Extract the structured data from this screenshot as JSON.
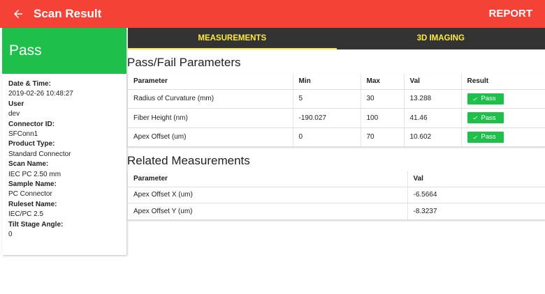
{
  "appbar": {
    "title": "Scan Result",
    "report_label": "REPORT",
    "color": "#f44336"
  },
  "summary": {
    "status": "Pass",
    "status_color": "#1fbf4c"
  },
  "info": [
    {
      "label": "Date & Time:",
      "value": "2019-02-26 10:48:27"
    },
    {
      "label": "User",
      "value": "dev"
    },
    {
      "label": "Connector ID:",
      "value": "SFConn1"
    },
    {
      "label": "Product Type:",
      "value": "Standard Connector"
    },
    {
      "label": "Scan Name:",
      "value": "IEC PC 2.50 mm"
    },
    {
      "label": "Sample Name:",
      "value": "PC Connector"
    },
    {
      "label": "Ruleset Name:",
      "value": "IEC/PC 2.5"
    },
    {
      "label": "Tilt Stage Angle:",
      "value": "0"
    }
  ],
  "tabs": [
    {
      "label": "MEASUREMENTS",
      "active": true
    },
    {
      "label": "3D IMAGING",
      "active": false
    }
  ],
  "pass_fail": {
    "title": "Pass/Fail Parameters",
    "headers": [
      "Parameter",
      "Min",
      "Max",
      "Val",
      "Result"
    ],
    "rows": [
      {
        "parameter": "Radius of Curvature (mm)",
        "min": "5",
        "max": "30",
        "val": "13.288",
        "result": "Pass"
      },
      {
        "parameter": "Fiber Height (nm)",
        "min": "-190.027",
        "max": "100",
        "val": "41.46",
        "result": "Pass"
      },
      {
        "parameter": "Apex Offset (um)",
        "min": "0",
        "max": "70",
        "val": "10.602",
        "result": "Pass"
      }
    ]
  },
  "related": {
    "title": "Related Measurements",
    "headers": [
      "Parameter",
      "Val"
    ],
    "rows": [
      {
        "parameter": "Apex Offset X (um)",
        "val": "-6.5664"
      },
      {
        "parameter": "Apex Offset Y (um)",
        "val": "-8.3237"
      }
    ]
  },
  "icons": {
    "back": "arrow-left-icon",
    "check": "check-icon"
  }
}
